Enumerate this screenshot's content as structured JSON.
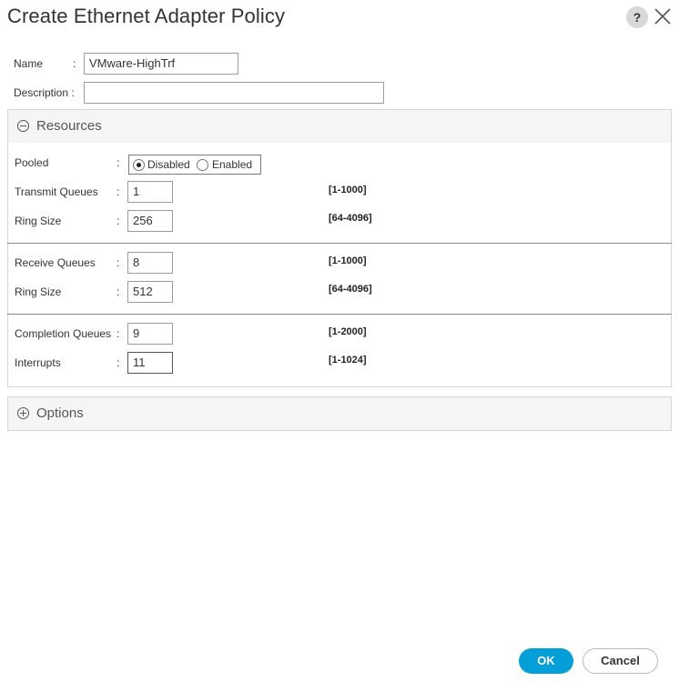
{
  "dialog": {
    "title": "Create Ethernet Adapter Policy",
    "help_icon_text": "?",
    "ok_label": "OK",
    "cancel_label": "Cancel",
    "accent_color": "#049fd9"
  },
  "general": {
    "name_label": "Name",
    "name_colon": ":",
    "name_value": "VMware-HighTrf",
    "description_label": "Description :",
    "description_value": ""
  },
  "resources": {
    "title": "Resources",
    "expanded": true,
    "pooled": {
      "label": "Pooled",
      "colon": ":",
      "options": [
        "Disabled",
        "Enabled"
      ],
      "selected": "Disabled"
    },
    "transmit_queues": {
      "label": "Transmit Queues",
      "colon": ":",
      "value": "1",
      "range": "[1-1000]"
    },
    "transmit_ring_size": {
      "label": "Ring Size",
      "colon": ":",
      "value": "256",
      "range": "[64-4096]"
    },
    "receive_queues": {
      "label": "Receive Queues",
      "colon": ":",
      "value": "8",
      "range": "[1-1000]"
    },
    "receive_ring_size": {
      "label": "Ring Size",
      "colon": ":",
      "value": "512",
      "range": "[64-4096]"
    },
    "completion_queues": {
      "label": "Completion Queues",
      "colon": ":",
      "value": "9",
      "range": "[1-2000]"
    },
    "interrupts": {
      "label": "Interrupts",
      "colon": ":",
      "value": "11",
      "range": "[1-1024]"
    }
  },
  "options": {
    "title": "Options",
    "expanded": false
  }
}
